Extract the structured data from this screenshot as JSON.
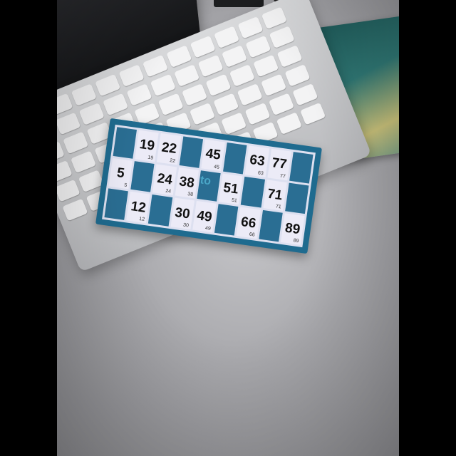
{
  "colors": {
    "card": "#1f6b8f",
    "cell": "#ecebf7",
    "filled": "#2a6e93"
  },
  "card": {
    "logo_text": "to",
    "rows": [
      [
        "",
        "19",
        "22",
        "",
        "45",
        "",
        "63",
        "77",
        ""
      ],
      [
        "5",
        "",
        "24",
        "38",
        "",
        "51",
        "",
        "71",
        ""
      ],
      [
        "",
        "12",
        "",
        "30",
        "49",
        "",
        "66",
        "",
        "89"
      ]
    ]
  }
}
